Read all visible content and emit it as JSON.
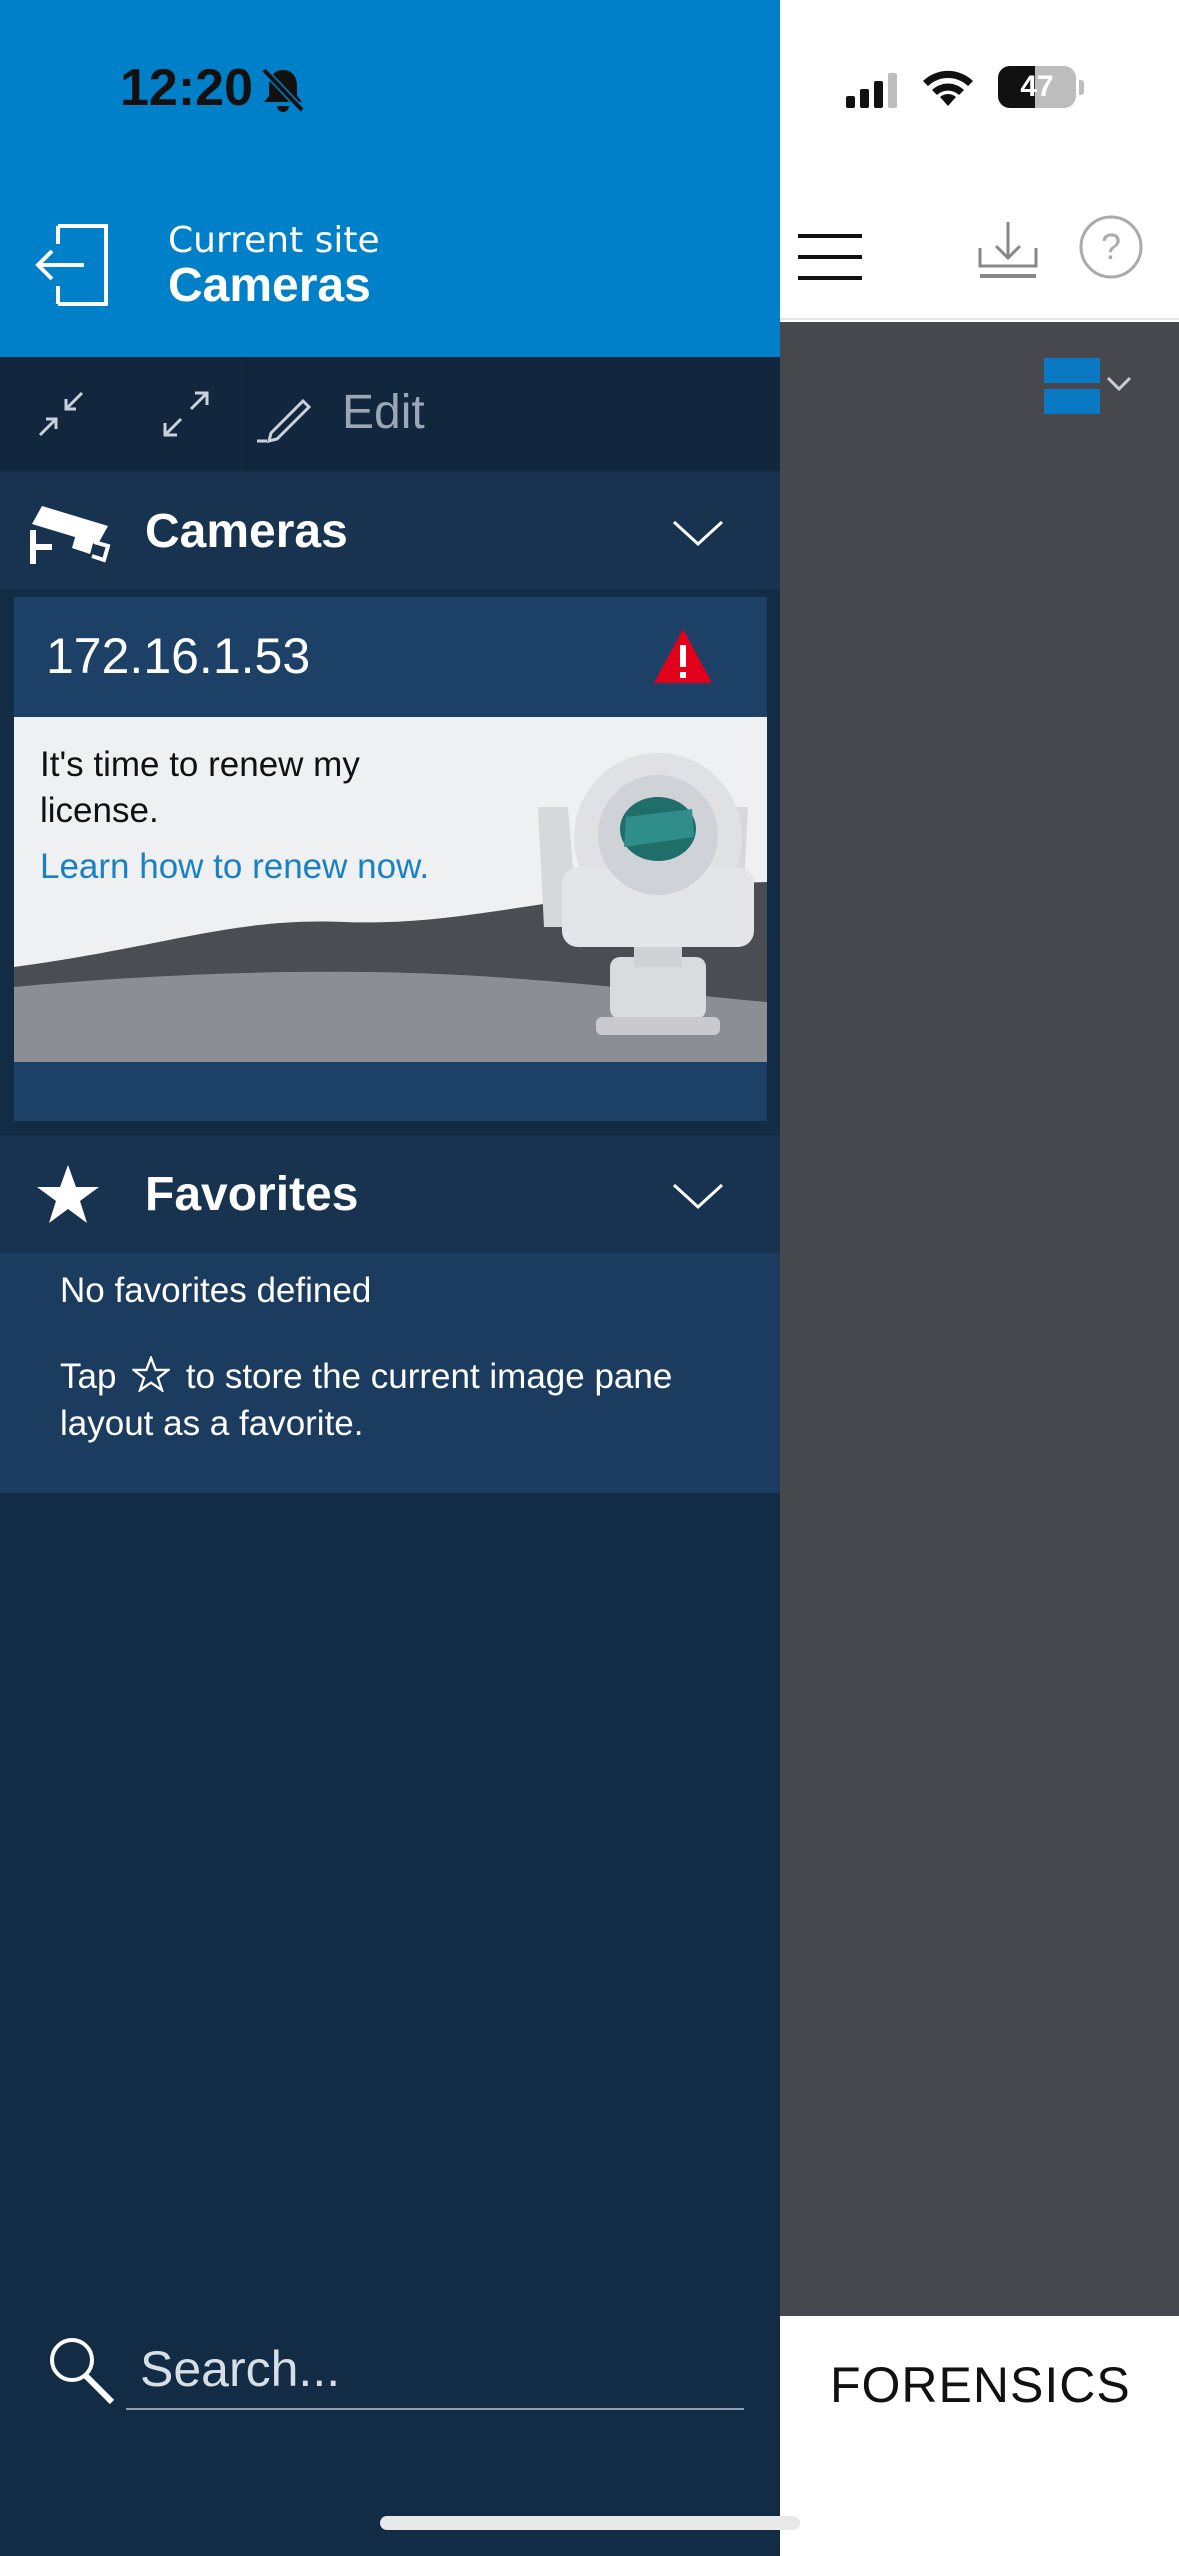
{
  "status_bar": {
    "time": "12:20",
    "battery": "47"
  },
  "header": {
    "site_caption": "Current site",
    "site_name": "Cameras"
  },
  "toolbar": {
    "edit_label": "Edit"
  },
  "cameras_section": {
    "title": "Cameras",
    "camera": {
      "ip": "172.16.1.53",
      "license_message": "It's time to renew my license.",
      "license_link": "Learn how to renew now."
    }
  },
  "favorites_section": {
    "title": "Favorites",
    "empty_text": "No favorites defined",
    "hint_before": "Tap",
    "hint_after": "to store the current image pane layout as a favorite."
  },
  "search": {
    "placeholder": "Search..."
  },
  "right_panel": {
    "bottom_tab": "FORENSICS"
  },
  "colors": {
    "brand_blue": "#0080c8",
    "drawer_bg": "#122c45",
    "warning_red": "#e2001a",
    "link_blue": "#1a80c4"
  }
}
